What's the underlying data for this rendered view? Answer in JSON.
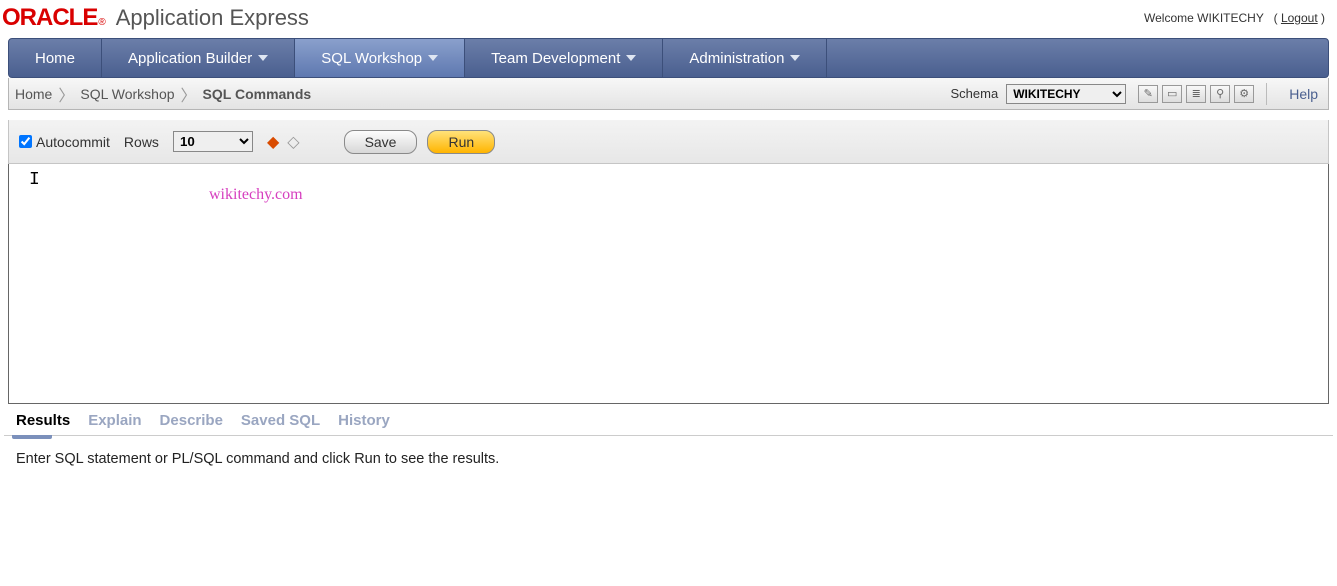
{
  "header": {
    "brand_main": "ORACLE",
    "brand_reg": "®",
    "brand_sub": "Application Express",
    "welcome_prefix": "Welcome ",
    "welcome_user": "WIKITECHY",
    "logout_label": "Logout"
  },
  "nav": {
    "items": [
      {
        "label": "Home",
        "has_caret": false,
        "active": false
      },
      {
        "label": "Application Builder",
        "has_caret": true,
        "active": false
      },
      {
        "label": "SQL Workshop",
        "has_caret": true,
        "active": true
      },
      {
        "label": "Team Development",
        "has_caret": true,
        "active": false
      },
      {
        "label": "Administration",
        "has_caret": true,
        "active": false
      }
    ]
  },
  "breadcrumb": {
    "items": [
      "Home",
      "SQL Workshop",
      "SQL Commands"
    ],
    "schema_label": "Schema",
    "schema_value": "WIKITECHY",
    "help_label": "Help"
  },
  "toolbar": {
    "autocommit_label": "Autocommit",
    "rows_label": "Rows",
    "rows_value": "10",
    "save_label": "Save",
    "run_label": "Run"
  },
  "editor": {
    "watermark": "wikitechy.com"
  },
  "tabs": {
    "items": [
      {
        "label": "Results",
        "active": true
      },
      {
        "label": "Explain",
        "active": false
      },
      {
        "label": "Describe",
        "active": false
      },
      {
        "label": "Saved SQL",
        "active": false
      },
      {
        "label": "History",
        "active": false
      }
    ]
  },
  "result": {
    "message": "Enter SQL statement or PL/SQL command and click Run to see the results."
  }
}
